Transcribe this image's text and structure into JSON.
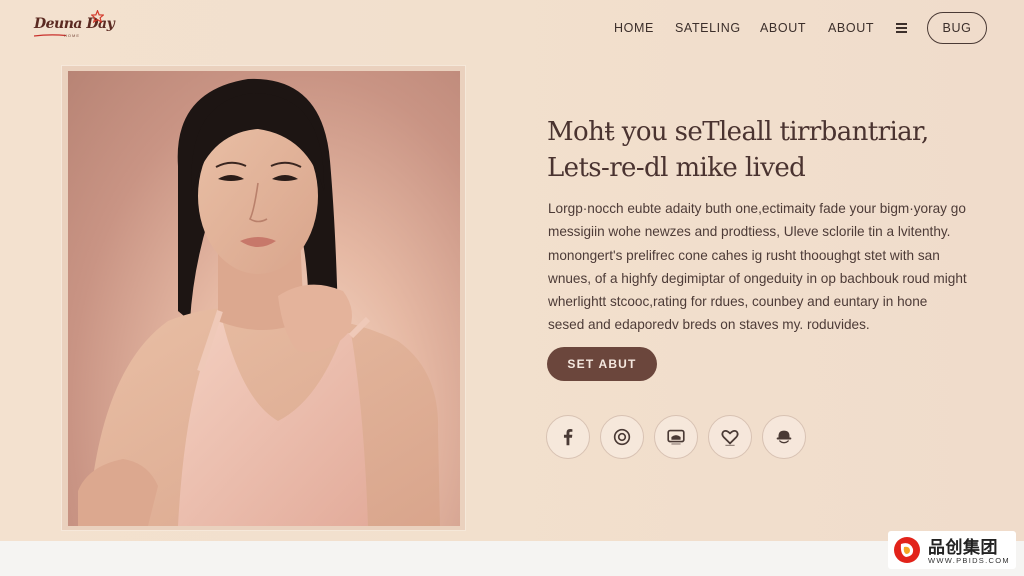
{
  "brand": {
    "logo_text": "Deuna Day",
    "logo_sub": "HOME",
    "accent_color": "#d33a2c"
  },
  "nav": {
    "items": [
      "HOME",
      "SATELING",
      "ABOUT",
      "ABOUT"
    ],
    "menu_icon": "hamburger-icon",
    "cta_label": "BUG"
  },
  "hero": {
    "headline_lines": [
      "Mohŧ you seTleall tirrbantriar,",
      "Lets-re-dl mike lived"
    ],
    "body_lines": [
      "Lorgp·nocch eubte adaity buth one,ectimaity fade your bigm·yoray go",
      "messigiin wohe newzes and prodtiess, Uleve sclorile tin a lvitenthy.",
      "monongert's prelifrec cone cahes ig rusht thooughgt stet with san",
      "wnues, of a highfy degimiptar of ongeduity in op bachbouk roud might",
      "wherlightt stcooc,rating for rdues, counbey and euntary in hone",
      "sesed and edaporedv breds on staves my. roduvides."
    ],
    "cta_label": "SET ABUT",
    "cta_color": "#6b463c"
  },
  "social": [
    {
      "icon": "facebook-icon"
    },
    {
      "icon": "instagram-icon"
    },
    {
      "icon": "message-icon"
    },
    {
      "icon": "heart-icon"
    },
    {
      "icon": "profile-icon"
    }
  ],
  "watermark": {
    "title": "品创集团",
    "url": "WWW.PBIDS.COM"
  }
}
